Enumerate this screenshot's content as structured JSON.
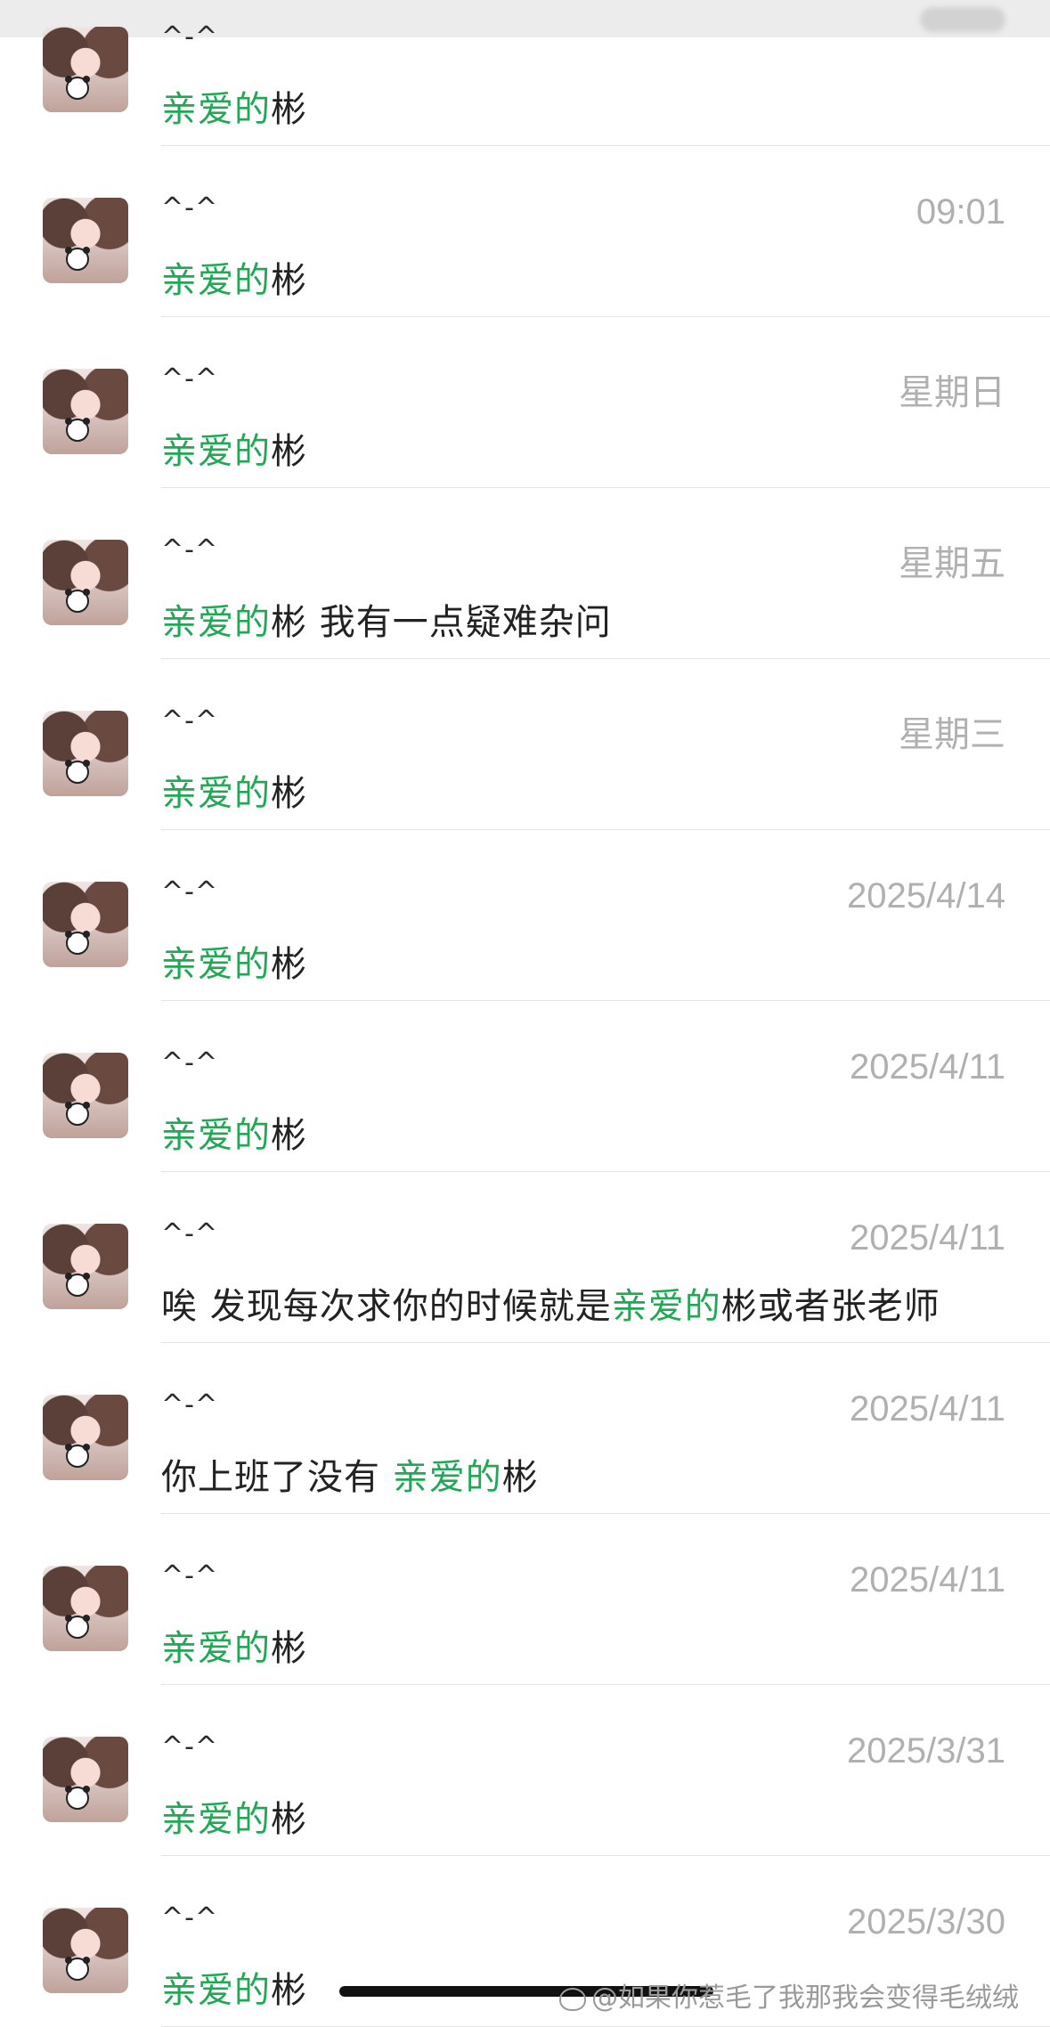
{
  "chats": [
    {
      "name": "^-^",
      "time": "",
      "message": [
        {
          "text": "亲爱的",
          "green": true
        },
        {
          "text": "彬",
          "green": false
        }
      ]
    },
    {
      "name": "^-^",
      "time": "09:01",
      "message": [
        {
          "text": "亲爱的",
          "green": true
        },
        {
          "text": "彬",
          "green": false
        }
      ]
    },
    {
      "name": "^-^",
      "time": "星期日",
      "message": [
        {
          "text": "亲爱的",
          "green": true
        },
        {
          "text": "彬",
          "green": false
        }
      ]
    },
    {
      "name": "^-^",
      "time": "星期五",
      "message": [
        {
          "text": "亲爱的",
          "green": true
        },
        {
          "text": "彬 我有一点疑难杂问",
          "green": false
        }
      ]
    },
    {
      "name": "^-^",
      "time": "星期三",
      "message": [
        {
          "text": "亲爱的",
          "green": true
        },
        {
          "text": "彬",
          "green": false
        }
      ]
    },
    {
      "name": "^-^",
      "time": "2025/4/14",
      "message": [
        {
          "text": "亲爱的",
          "green": true
        },
        {
          "text": "彬",
          "green": false
        }
      ]
    },
    {
      "name": "^-^",
      "time": "2025/4/11",
      "message": [
        {
          "text": "亲爱的",
          "green": true
        },
        {
          "text": "彬",
          "green": false
        }
      ]
    },
    {
      "name": "^-^",
      "time": "2025/4/11",
      "message": [
        {
          "text": "唉 发现每次求你的时候就是",
          "green": false
        },
        {
          "text": "亲爱的",
          "green": true
        },
        {
          "text": "彬或者张老师",
          "green": false
        }
      ]
    },
    {
      "name": "^-^",
      "time": "2025/4/11",
      "message": [
        {
          "text": "你上班了没有 ",
          "green": false
        },
        {
          "text": "亲爱的",
          "green": true
        },
        {
          "text": "彬",
          "green": false
        }
      ]
    },
    {
      "name": "^-^",
      "time": "2025/4/11",
      "message": [
        {
          "text": "亲爱的",
          "green": true
        },
        {
          "text": "彬",
          "green": false
        }
      ]
    },
    {
      "name": "^-^",
      "time": "2025/3/31",
      "message": [
        {
          "text": "亲爱的",
          "green": true
        },
        {
          "text": "彬",
          "green": false
        }
      ]
    },
    {
      "name": "^-^",
      "time": "2025/3/30",
      "message": [
        {
          "text": "亲爱的",
          "green": true
        },
        {
          "text": "彬",
          "green": false
        }
      ]
    }
  ],
  "watermark": "@如果你惹毛了我那我会变得毛绒绒",
  "colors": {
    "highlight": "#20a854",
    "time": "#b0b0b0"
  }
}
